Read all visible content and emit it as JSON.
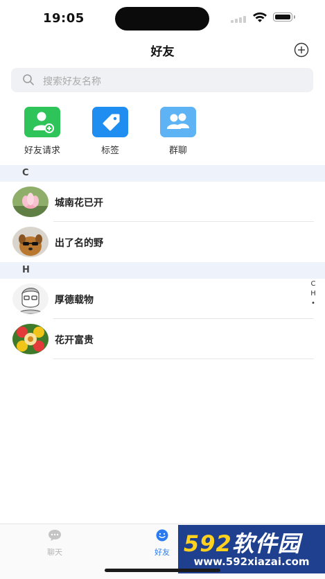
{
  "status_bar": {
    "time": "19:05"
  },
  "header": {
    "title": "好友"
  },
  "search": {
    "placeholder": "搜索好友名称"
  },
  "shortcuts": [
    {
      "label": "好友请求",
      "icon": "add-user-icon",
      "color": "#2ec45a"
    },
    {
      "label": "标签",
      "icon": "tag-icon",
      "color": "#1f8ef0"
    },
    {
      "label": "群聊",
      "icon": "group-icon",
      "color": "#5db3f3"
    }
  ],
  "sections": [
    {
      "letter": "C",
      "contacts": [
        {
          "name": "城南花已开"
        },
        {
          "name": "出了名的野"
        }
      ]
    },
    {
      "letter": "H",
      "contacts": [
        {
          "name": "厚德载物"
        },
        {
          "name": "花开富贵"
        }
      ]
    }
  ],
  "index_bar": [
    "C",
    "H",
    "•"
  ],
  "tabbar": {
    "items": [
      {
        "label": "聊天",
        "active": false
      },
      {
        "label": "好友",
        "active": true
      }
    ],
    "active_color": "#2b7bf0",
    "inactive_color": "#b5b5b5"
  },
  "watermark": {
    "brand_num": "592",
    "brand_text": "软件园",
    "url": "www.592xiazai.com"
  }
}
